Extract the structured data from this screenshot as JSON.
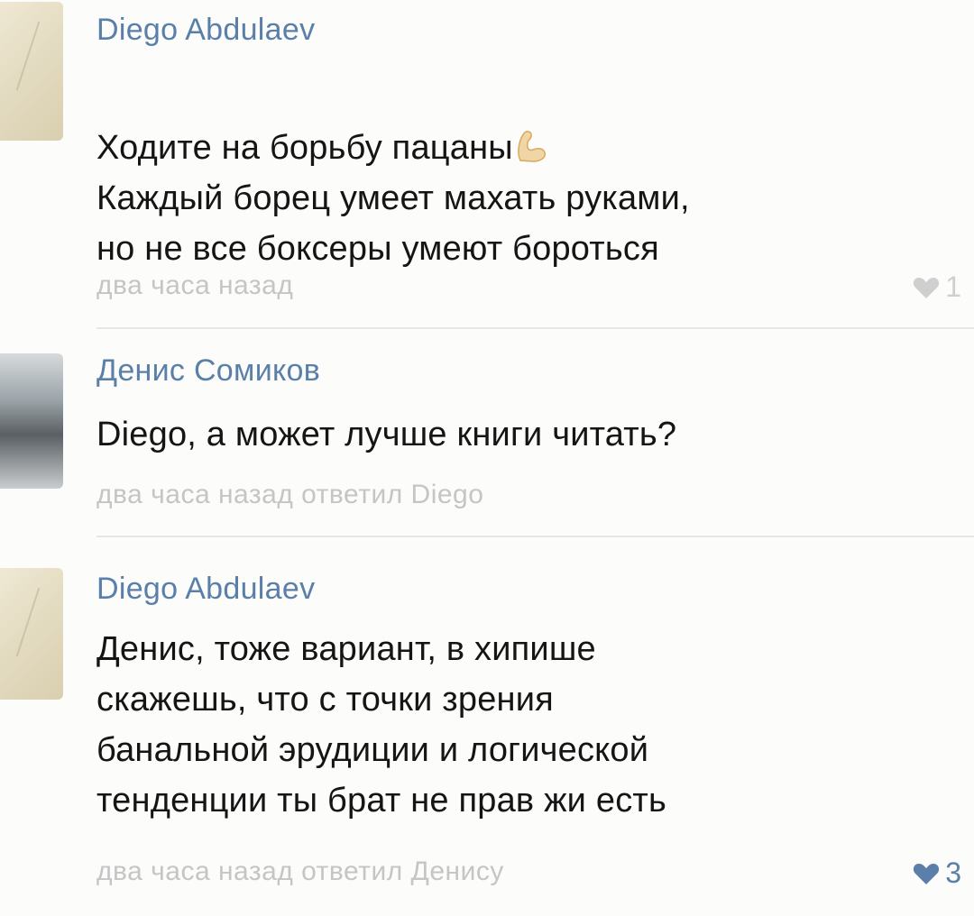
{
  "comments": [
    {
      "author": "Diego Abdulaev",
      "text": "Ходите на борьбу пацаны",
      "emoji": "flexed-biceps-icon",
      "text_rest": "Каждый борец умеет махать руками,\nно не все боксеры умеют бороться",
      "meta": "два часа назад",
      "likes": "1",
      "liked": false
    },
    {
      "author": "Денис Сомиков",
      "text": "Diego, а может лучше книги читать?",
      "meta": "два часа назад ответил Diego"
    },
    {
      "author": "Diego Abdulaev",
      "text": "Денис, тоже вариант, в хипише\nскажешь, что с точки зрения\nбанальной эрудиции и логической\nтенденции ты брат не прав жи есть",
      "meta": "два часа назад ответил Денису",
      "likes": "3",
      "liked": true
    }
  ],
  "colors": {
    "author": "#5a7fa8",
    "meta": "#c5c5c5",
    "heart_inactive": "#cfcfcf",
    "heart_active": "#5a7fa8"
  }
}
